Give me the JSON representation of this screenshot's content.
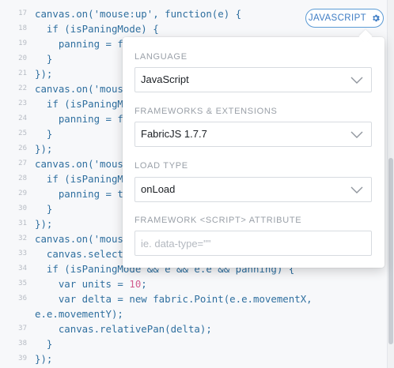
{
  "editor": {
    "lines": [
      {
        "num": "17",
        "text": "canvas.on('mouse:up', function(e) {"
      },
      {
        "num": "18",
        "text": "  if (isPaningMode) {"
      },
      {
        "num": "19",
        "text": "    panning = fa"
      },
      {
        "num": "20",
        "text": "  }"
      },
      {
        "num": "21",
        "text": "});"
      },
      {
        "num": "22",
        "text": "canvas.on('mouse"
      },
      {
        "num": "23",
        "text": "  if (isPaningMo"
      },
      {
        "num": "24",
        "text": "    panning = fa"
      },
      {
        "num": "25",
        "text": "  }"
      },
      {
        "num": "26",
        "text": "});"
      },
      {
        "num": "27",
        "text": "canvas.on('mouse"
      },
      {
        "num": "28",
        "text": "  if (isPaningMo"
      },
      {
        "num": "29",
        "text": "    panning = tr"
      },
      {
        "num": "30",
        "text": "  }"
      },
      {
        "num": "31",
        "text": "});"
      },
      {
        "num": "32",
        "text": "canvas.on('mouse"
      },
      {
        "num": "33",
        "text": "  canvas.selecti"
      },
      {
        "num": "34",
        "text": "  if (isPaningMode && e && e.e && panning) {"
      },
      {
        "num": "35",
        "text": "    var units = 10;"
      },
      {
        "num": "36",
        "text": "    var delta = new fabric.Point(e.e.movementX,"
      },
      {
        "num": "",
        "text": "e.e.movementY);"
      },
      {
        "num": "37",
        "text": "    canvas.relativePan(delta);"
      },
      {
        "num": "38",
        "text": "  }"
      },
      {
        "num": "39",
        "text": "});"
      }
    ]
  },
  "badge": {
    "label": "JAVASCRIPT",
    "icon": "gear-icon"
  },
  "settings": {
    "language_label": "LANGUAGE",
    "language_value": "JavaScript",
    "frameworks_label": "FRAMEWORKS & EXTENSIONS",
    "frameworks_value": "FabricJS 1.7.7",
    "load_type_label": "LOAD TYPE",
    "load_type_value": "onLoad",
    "attribute_label": "FRAMEWORK <SCRIPT> ATTRIBUTE",
    "attribute_placeholder": "ie. data-type=\"\""
  },
  "colors": {
    "code": "#2f6f9f",
    "number": "#d25c8e",
    "accent": "#3d7cc4"
  }
}
